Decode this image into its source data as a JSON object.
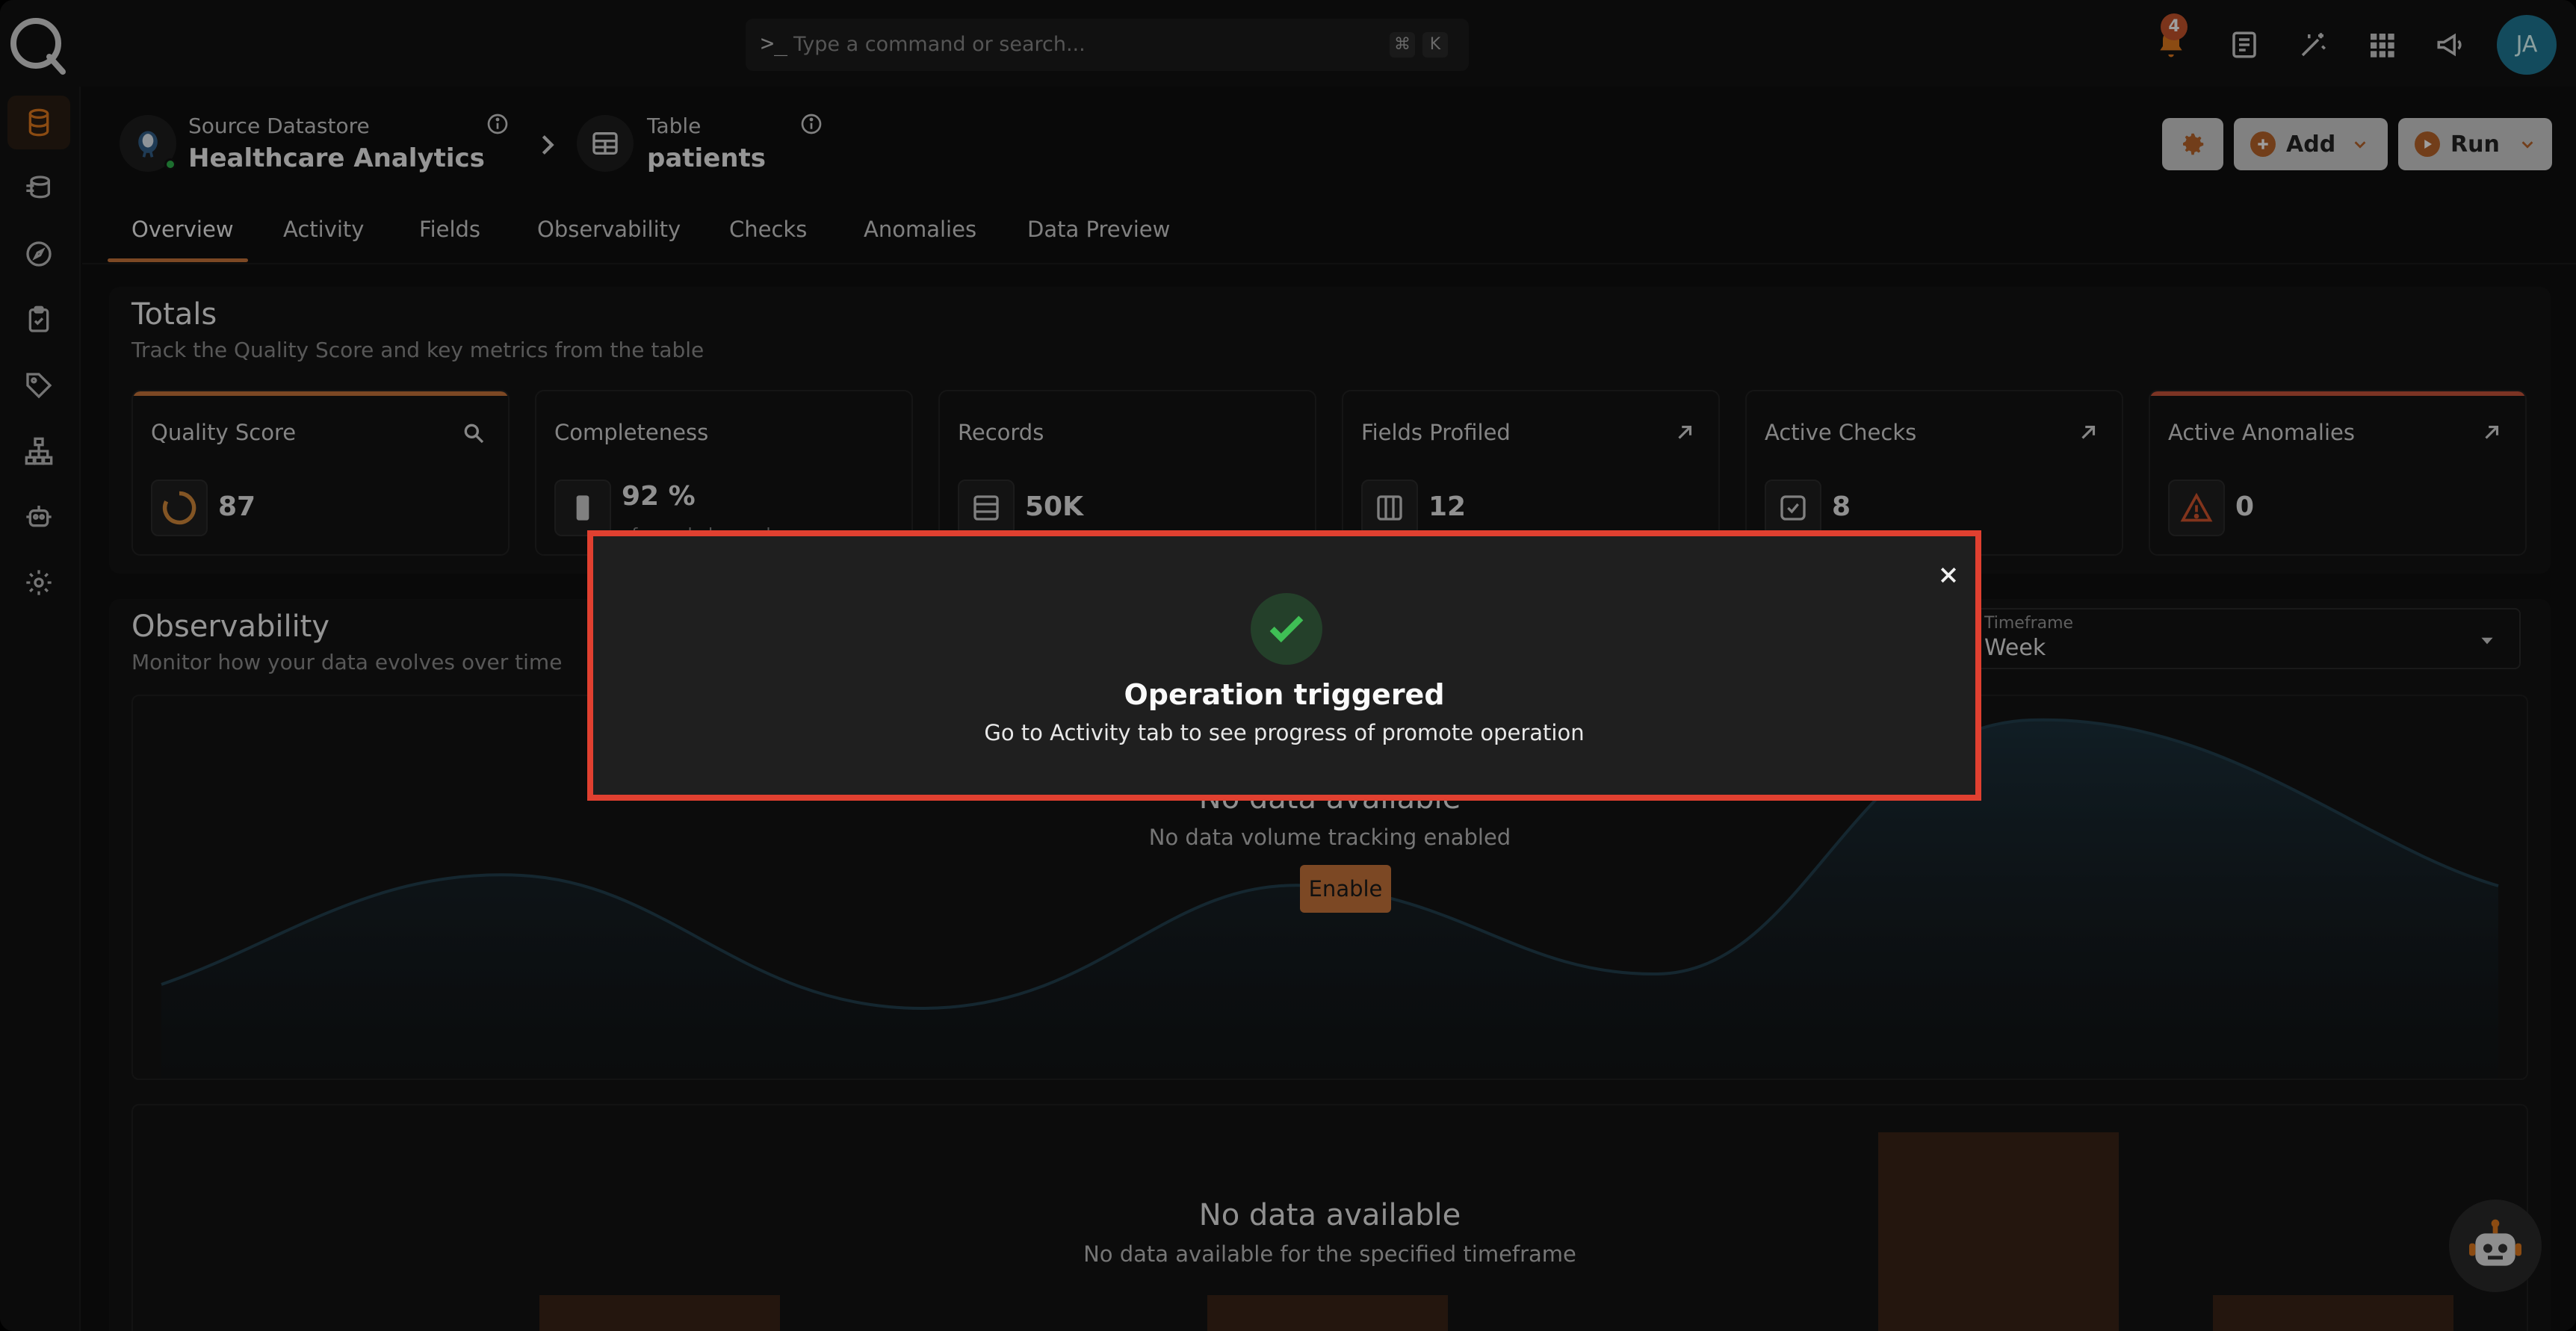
{
  "search": {
    "prompt_symbol": ">_",
    "placeholder": "Type a command or search...",
    "shortcut_mod": "⌘",
    "shortcut_key": "K"
  },
  "header": {
    "notification_count": "4",
    "avatar_initials": "JA"
  },
  "breadcrumb": {
    "datastore_type": "Source Datastore",
    "datastore_name": "Healthcare Analytics",
    "table_type": "Table",
    "table_name": "patients"
  },
  "actions": {
    "add_label": "Add",
    "run_label": "Run"
  },
  "tabs": [
    "Overview",
    "Activity",
    "Fields",
    "Observability",
    "Checks",
    "Anomalies",
    "Data Preview"
  ],
  "totals": {
    "title": "Totals",
    "subtitle": "Track the Quality Score and key metrics from the table",
    "cards": [
      {
        "label": "Quality Score",
        "value": "87"
      },
      {
        "label": "Completeness",
        "value": "92 %",
        "sub": "of sampled records"
      },
      {
        "label": "Records",
        "value": "50K"
      },
      {
        "label": "Fields Profiled",
        "value": "12"
      },
      {
        "label": "Active Checks",
        "value": "8"
      },
      {
        "label": "Active Anomalies",
        "value": "0"
      }
    ]
  },
  "observability": {
    "title": "Observability",
    "subtitle": "Monitor how your data evolves over time",
    "timeframe_label": "Timeframe",
    "timeframe_value": "Week",
    "volume_empty_title": "No data available",
    "volume_empty_sub": "No data volume tracking enabled",
    "enable_label": "Enable",
    "freshness_empty_title": "No data available",
    "freshness_empty_sub": "No data available for the specified timeframe"
  },
  "modal": {
    "title": "Operation triggered",
    "message": "Go to Activity tab to see progress of promote operation"
  },
  "colors": {
    "accent": "#c8743a",
    "danger": "#e04030",
    "success": "#3fbf55",
    "avatar": "#1f7a97"
  }
}
